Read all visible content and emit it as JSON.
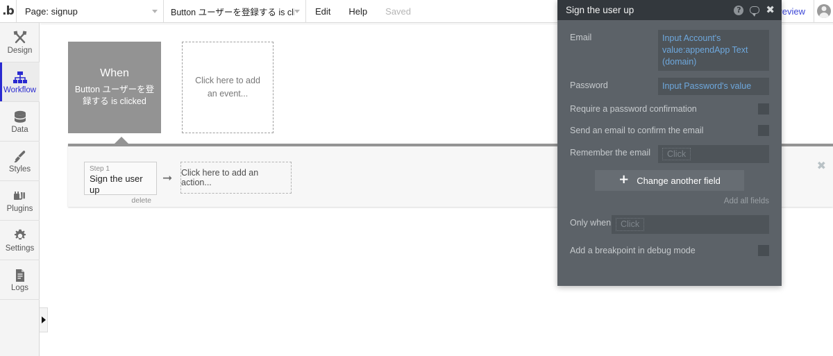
{
  "topbar": {
    "logo": "b-logo-icon",
    "page_label": "Page: signup",
    "workflow_label": "Button ユーザーを登録する is clic...",
    "edit_label": "Edit",
    "help_label": "Help",
    "saved_label": "Saved",
    "preview_label": "Preview"
  },
  "sidebar": {
    "items": [
      {
        "label": "Design",
        "icon": "design-tools-icon",
        "active": false
      },
      {
        "label": "Workflow",
        "icon": "workflow-tree-icon",
        "active": true
      },
      {
        "label": "Data",
        "icon": "database-icon",
        "active": false
      },
      {
        "label": "Styles",
        "icon": "paintbrush-icon",
        "active": false
      },
      {
        "label": "Plugins",
        "icon": "plug-icon",
        "active": false
      },
      {
        "label": "Settings",
        "icon": "gear-icon",
        "active": false
      },
      {
        "label": "Logs",
        "icon": "document-lines-icon",
        "active": false
      }
    ],
    "expand_icon": "triangle-right-icon"
  },
  "canvas": {
    "event": {
      "title": "When",
      "subtitle": "Button ユーザーを登録する is clicked"
    },
    "add_event_placeholder": "Click here to add an event...",
    "action_panel": {
      "step_number": "Step 1",
      "step_title": "Sign the user up",
      "step_delete": "delete",
      "arrow_icon": "arrow-right-icon",
      "add_action_placeholder": "Click here to add an action...",
      "close_icon": "close-icon"
    }
  },
  "dialog": {
    "title": "Sign the user up",
    "icons": {
      "help": "question-circle-icon",
      "comment": "speech-bubble-icon",
      "close": "close-icon"
    },
    "fields": [
      {
        "label": "Email",
        "value": "Input Account's value:appendApp Text (domain)",
        "type": "expression"
      },
      {
        "label": "Password",
        "value": "Input Password's value",
        "type": "expression"
      }
    ],
    "checkboxes": [
      {
        "label": "Require a password confirmation",
        "checked": false
      },
      {
        "label": "Send an email to confirm the email",
        "checked": false
      }
    ],
    "remember": {
      "label": "Remember the email",
      "placeholder": "Click"
    },
    "change_field_button": "Change another field",
    "add_all_fields": "Add all fields",
    "only_when": {
      "label": "Only when",
      "placeholder": "Click"
    },
    "breakpoint": {
      "label": "Add a breakpoint in debug mode",
      "checked": false
    }
  },
  "colors": {
    "accent_blue": "#2a2ad0",
    "preview_blue": "#3b45d6",
    "expression_blue": "#6ea8dd",
    "dialog_bg": "#5c6268",
    "dialog_header": "#33383d",
    "event_block": "#939393"
  }
}
